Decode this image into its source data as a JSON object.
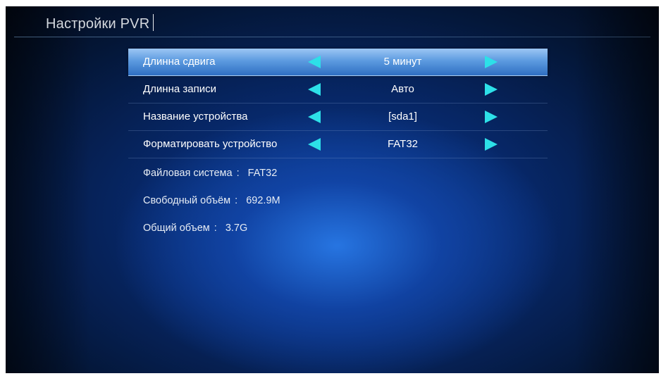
{
  "header": {
    "title": "Настройки PVR"
  },
  "menu": {
    "items": [
      {
        "label": "Длинна сдвига",
        "value": "5 минут",
        "selected": true
      },
      {
        "label": "Длинна записи",
        "value": "Авто",
        "selected": false
      },
      {
        "label": "Название устройства",
        "value": "[sda1]",
        "selected": false
      },
      {
        "label": "Форматировать устройство",
        "value": "FAT32",
        "selected": false
      }
    ]
  },
  "info": {
    "separator": ":",
    "filesystem": {
      "label": "Файловая система",
      "value": "FAT32"
    },
    "free_space": {
      "label": "Свободный объём",
      "value": "692.9M"
    },
    "total_space": {
      "label": "Общий объем",
      "value": "3.7G"
    }
  },
  "icons": {
    "left_arrow": "arrow-left-icon",
    "right_arrow": "arrow-right-icon"
  },
  "colors": {
    "arrow": "#2de0e8",
    "selected_row": "#5d9be0",
    "background": "#072767"
  }
}
